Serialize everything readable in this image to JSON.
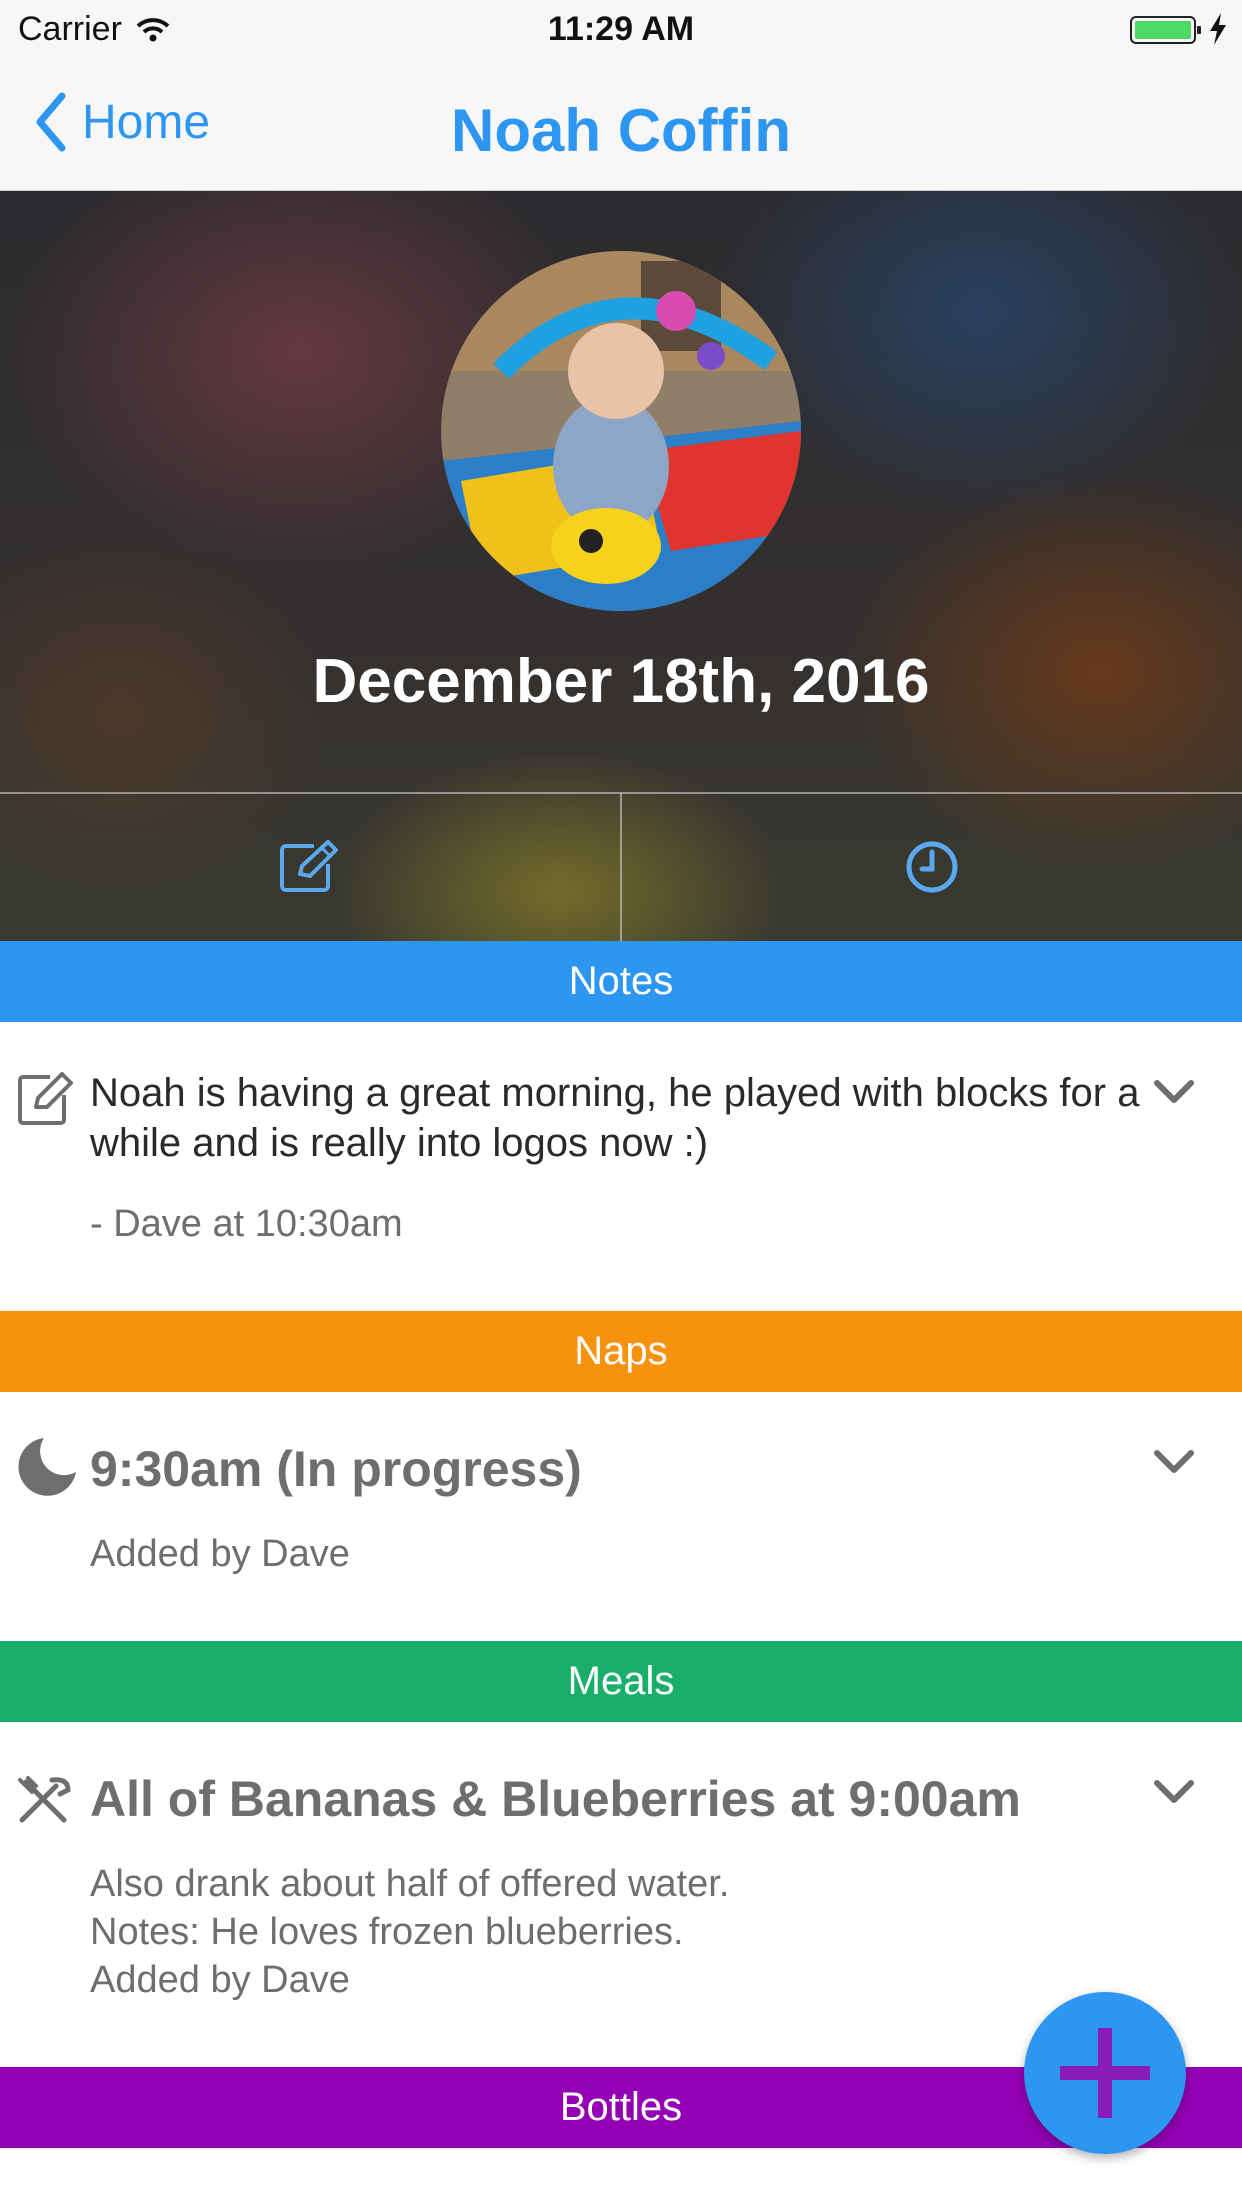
{
  "status_bar": {
    "carrier": "Carrier",
    "time": "11:29 AM"
  },
  "nav": {
    "back_label": "Home",
    "title": "Noah Coffin"
  },
  "hero": {
    "date": "December 18th, 2016",
    "edit_icon": "edit-icon",
    "clock_icon": "clock-icon"
  },
  "colors": {
    "accent": "#2d96f0",
    "notes": "#2d96f0",
    "naps": "#f7920f",
    "meals": "#19ae6a",
    "bottles": "#9400b4",
    "fab_plus": "#8a1cb8"
  },
  "sections": {
    "notes": {
      "header": "Notes",
      "entry": {
        "icon": "note-icon",
        "text": "Noah is having a great morning, he played with blocks for a while and is really into logos now :)",
        "author": "- Dave at 10:30am"
      }
    },
    "naps": {
      "header": "Naps",
      "entry": {
        "icon": "moon-icon",
        "title": "9:30am (In progress)",
        "added_by": "Added by Dave"
      }
    },
    "meals": {
      "header": "Meals",
      "entry": {
        "icon": "utensils-icon",
        "title": "All of Bananas & Blueberries at 9:00am",
        "detail_1": "Also drank about half of offered water.",
        "detail_2": "Notes: He loves frozen blueberries.",
        "added_by": "Added by Dave"
      }
    },
    "bottles": {
      "header": "Bottles"
    }
  },
  "fab": {
    "icon": "plus-icon"
  }
}
